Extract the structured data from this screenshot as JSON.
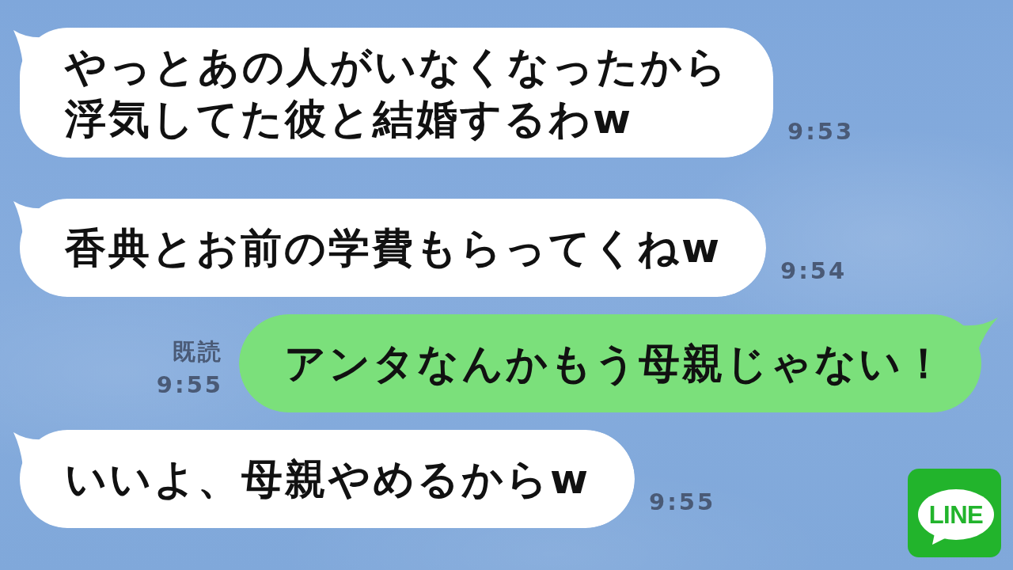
{
  "messages": [
    {
      "kind": "incoming",
      "lines": [
        "やっとあの人がいなくなったから",
        "浮気してた彼と結婚するわw"
      ],
      "time": "9:53"
    },
    {
      "kind": "incoming",
      "lines": [
        "香典とお前の学費もらってくねw"
      ],
      "time": "9:54"
    },
    {
      "kind": "outgoing",
      "lines": [
        "アンタなんかもう母親じゃない！"
      ],
      "read_label": "既読",
      "time": "9:55"
    },
    {
      "kind": "incoming",
      "lines": [
        "いいよ、母親やめるからw"
      ],
      "time": "9:55"
    }
  ],
  "logo": {
    "text": "LINE"
  }
}
